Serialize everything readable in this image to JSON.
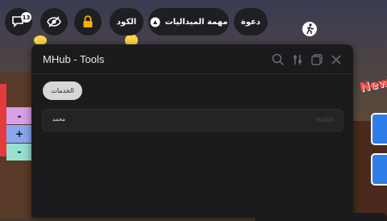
{
  "topbar": {
    "chat_badge": "13",
    "code_label": "الكود",
    "medals_label": "مهمة الميداليات",
    "invite_label": "دعوة"
  },
  "background": {
    "grid_buttons": [
      "-",
      "+",
      "-"
    ],
    "new_tag": "New"
  },
  "window": {
    "title": "MHub - Tools",
    "tab_label": "الخدمات",
    "row": {
      "label": "محمد",
      "hint": "button"
    }
  },
  "colors": {
    "window_bg": "#1b1b1d",
    "tab_bg": "#d7d7d7",
    "pill_bg": "#1e1f23"
  }
}
